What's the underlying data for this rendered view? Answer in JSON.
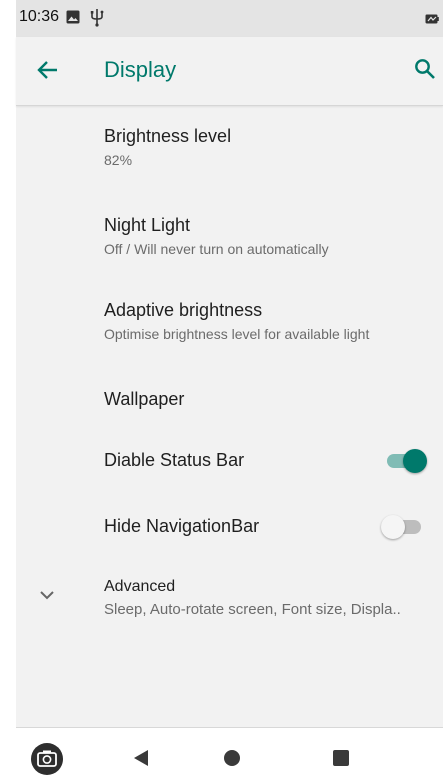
{
  "status_bar": {
    "time": "10:36",
    "icons": [
      "image-icon",
      "usb-icon",
      "battery-icon"
    ]
  },
  "app_bar": {
    "title": "Display",
    "accent_color": "#00796b",
    "icons": [
      "back-arrow-icon",
      "search-icon"
    ]
  },
  "settings": {
    "brightness": {
      "title": "Brightness level",
      "summary": "82%"
    },
    "night_light": {
      "title": "Night Light",
      "summary": "Off / Will never turn on automatically"
    },
    "adaptive": {
      "title": "Adaptive brightness",
      "summary": "Optimise brightness level for available light"
    },
    "wallpaper": {
      "title": "Wallpaper"
    },
    "status_bar_toggle": {
      "title": "Diable Status Bar",
      "enabled": true
    },
    "nav_bar_toggle": {
      "title": "Hide NavigationBar",
      "enabled": false
    },
    "advanced": {
      "title": "Advanced",
      "summary": "Sleep, Auto-rotate screen, Font size, Displa.."
    }
  },
  "nav_bar": {
    "icons": [
      "camera-icon",
      "back-triangle-icon",
      "home-circle-icon",
      "recents-square-icon"
    ]
  }
}
